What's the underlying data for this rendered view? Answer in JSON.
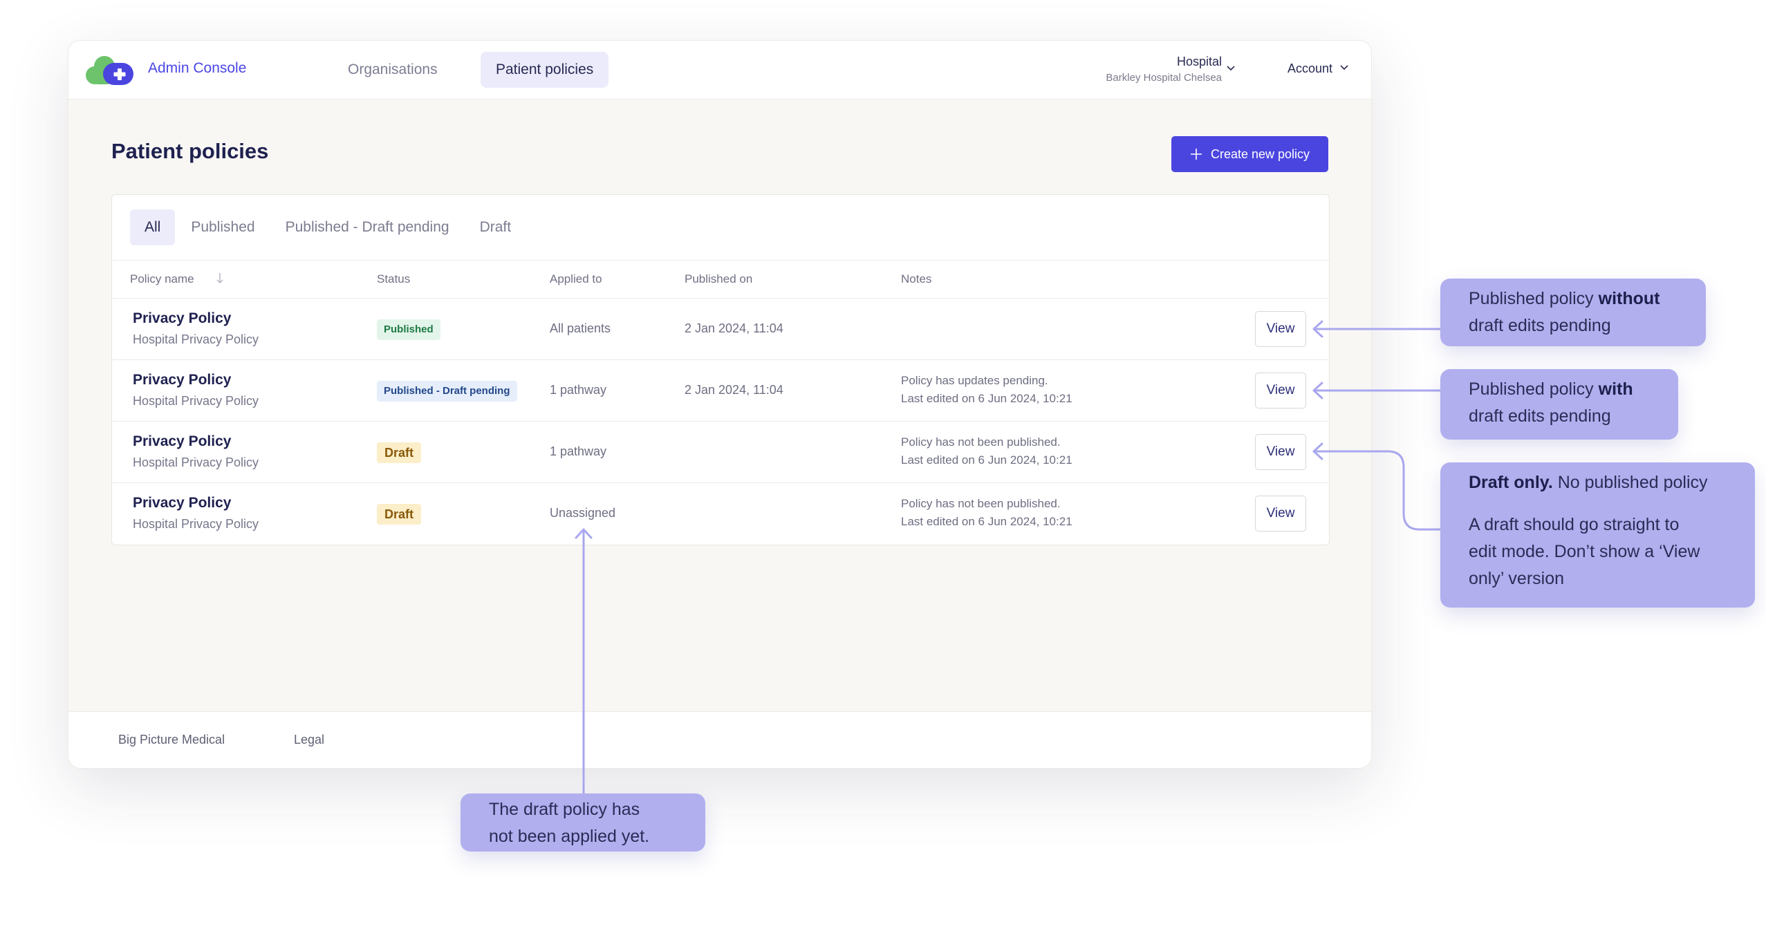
{
  "header": {
    "brand": "Admin Console",
    "nav": [
      {
        "label": "Organisations",
        "active": false
      },
      {
        "label": "Patient policies",
        "active": true
      }
    ],
    "hospital": {
      "label": "Hospital",
      "name": "Barkley Hospital Chelsea"
    },
    "account_label": "Account"
  },
  "page": {
    "title": "Patient policies",
    "create_button": "Create new policy"
  },
  "tabs": [
    {
      "label": "All",
      "active": true
    },
    {
      "label": "Published",
      "active": false
    },
    {
      "label": "Published - Draft pending",
      "active": false
    },
    {
      "label": "Draft",
      "active": false
    }
  ],
  "columns": [
    "Policy name",
    "Status",
    "Applied to",
    "Published on",
    "Notes"
  ],
  "rows": [
    {
      "name": "Privacy Policy",
      "description": "Hospital Privacy Policy",
      "status": "Published",
      "applied_to": "All patients",
      "published_on": "2 Jan 2024, 11:04",
      "note_line1": "",
      "note_line2": "",
      "action": "View"
    },
    {
      "name": "Privacy Policy",
      "description": "Hospital Privacy Policy",
      "status": "Published - Draft pending",
      "applied_to": "1 pathway",
      "published_on": "2 Jan 2024, 11:04",
      "note_line1": "Policy has updates pending.",
      "note_line2": "Last edited on 6 Jun 2024, 10:21",
      "action": "View"
    },
    {
      "name": "Privacy Policy",
      "description": "Hospital Privacy Policy",
      "status": "Draft",
      "applied_to": "1 pathway",
      "published_on": "",
      "note_line1": "Policy has not been published.",
      "note_line2": "Last edited on 6 Jun 2024, 10:21",
      "action": "View"
    },
    {
      "name": "Privacy Policy",
      "description": "Hospital Privacy Policy",
      "status": "Draft",
      "applied_to": "Unassigned",
      "published_on": "",
      "note_line1": "Policy has not been published.",
      "note_line2": "Last edited on 6 Jun 2024, 10:21",
      "action": "View"
    }
  ],
  "footer": {
    "links": [
      "Big Picture Medical",
      "Legal"
    ]
  },
  "annotations": {
    "a1": {
      "line1_pre": "Published policy ",
      "line1_bold": "without",
      "line2": "draft edits pending"
    },
    "a2": {
      "line1_pre": "Published policy ",
      "line1_bold": "with",
      "line2": "draft edits pending"
    },
    "a3": {
      "bold": "Draft only.",
      "rest": " No published policy",
      "line2": "A draft should go straight to",
      "line3": "edit mode. Don’t show a ‘View",
      "line4": "only’ version"
    },
    "a4": {
      "line1": "The draft policy has",
      "line2": "not been applied yet."
    }
  },
  "colors": {
    "primary": "#4b45e0",
    "annotation_bg": "#b1afee",
    "arrow": "#a9a7ee",
    "logo_green": "#6cc36b",
    "badge_published": "#e3f5ea",
    "badge_pending": "#e6eefb",
    "badge_draft": "#fbeec8"
  }
}
